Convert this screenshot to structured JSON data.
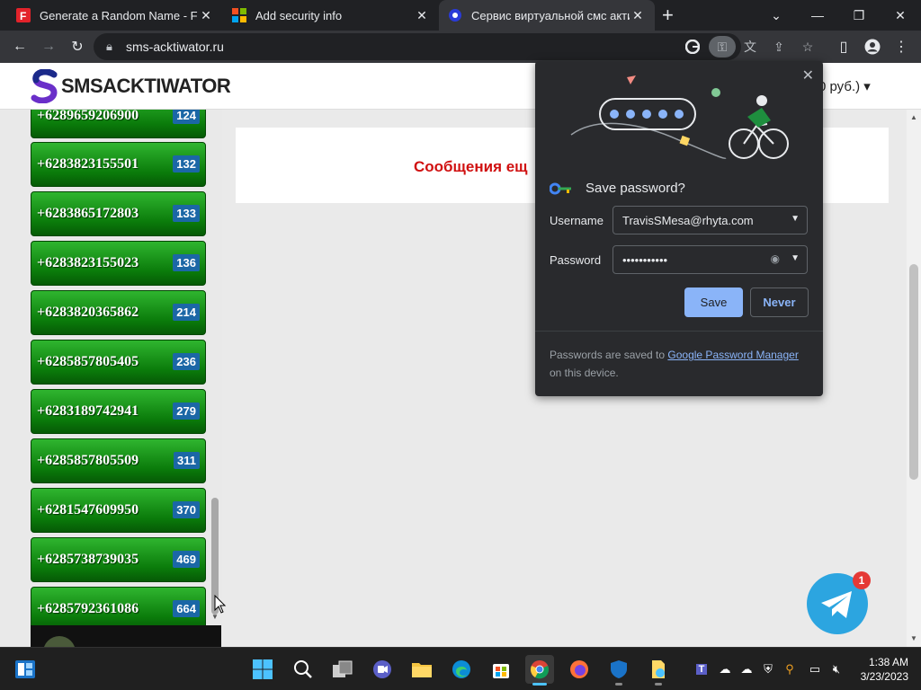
{
  "browser": {
    "tabs": [
      {
        "title": "Generate a Random Name - Fake",
        "icon": "fakename-icon"
      },
      {
        "title": "Add security info",
        "icon": "microsoft-icon"
      },
      {
        "title": "Сервис виртуальной смс актива",
        "icon": "sms-site-icon"
      }
    ],
    "url": "sms-acktiwator.ru"
  },
  "site": {
    "logo_text": "SMSACKTIWATOR",
    "balance": "0 руб.)",
    "numbers": [
      {
        "number": "+6289659206900",
        "count": "124"
      },
      {
        "number": "+6283823155501",
        "count": "132"
      },
      {
        "number": "+6283865172803",
        "count": "133"
      },
      {
        "number": "+6283823155023",
        "count": "136"
      },
      {
        "number": "+6283820365862",
        "count": "214"
      },
      {
        "number": "+6285857805405",
        "count": "236"
      },
      {
        "number": "+6283189742941",
        "count": "279"
      },
      {
        "number": "+6285857805509",
        "count": "311"
      },
      {
        "number": "+6281547609950",
        "count": "370"
      },
      {
        "number": "+6285738739035",
        "count": "469"
      },
      {
        "number": "+6285792361086",
        "count": "664"
      }
    ],
    "message": "Сообщения ещ",
    "telegram_badge": "1"
  },
  "save_password": {
    "title": "Save password?",
    "username_label": "Username",
    "username_value": "TravisSMesa@rhyta.com",
    "password_label": "Password",
    "password_value": "•••••••••••",
    "save_label": "Save",
    "never_label": "Never",
    "footer_prefix": "Passwords are saved to ",
    "footer_link": "Google Password Manager",
    "footer_suffix": " on this device."
  },
  "taskbar": {
    "time": "1:38 AM",
    "date": "3/23/2023"
  },
  "colors": {
    "accent_blue": "#8ab4f8",
    "number_green": "#0a7a0a",
    "count_blue": "#1b67a6",
    "message_red": "#d01010",
    "telegram": "#2ca5e0"
  }
}
